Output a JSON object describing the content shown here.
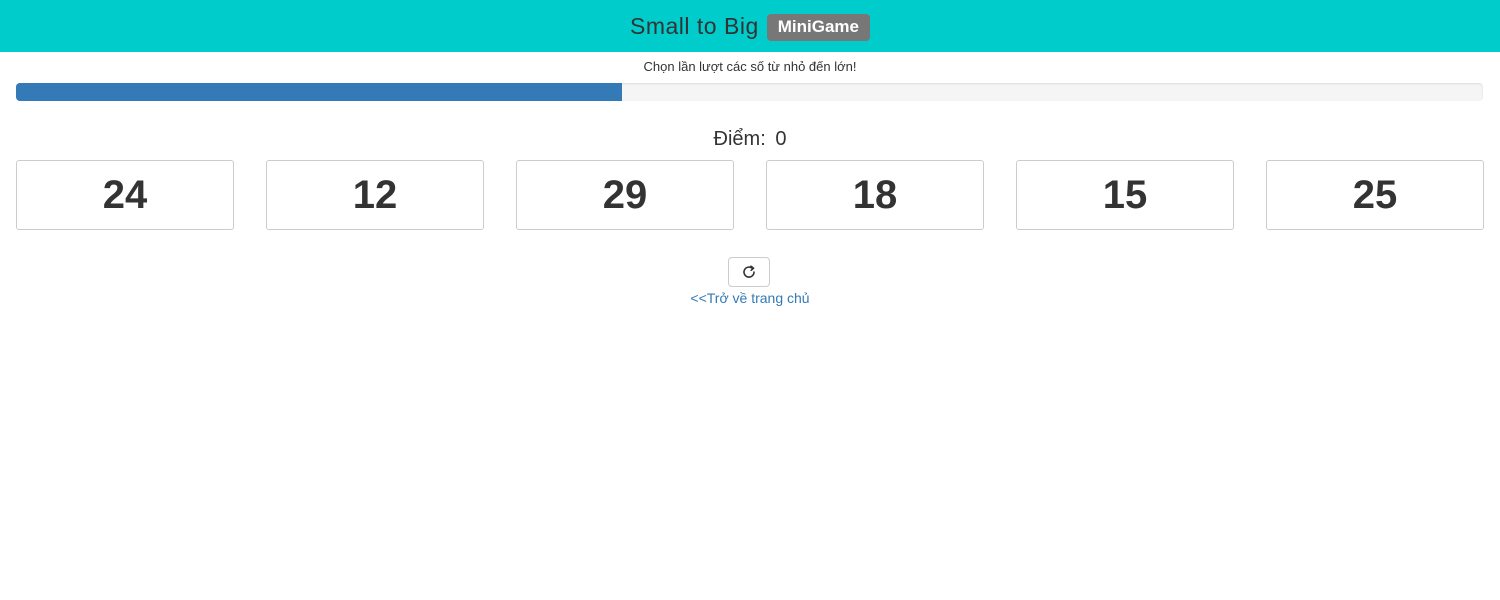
{
  "header": {
    "title": "Small to Big",
    "badge": "MiniGame",
    "background_color": "#00cccc"
  },
  "instruction": "Chọn lần lượt các số từ nhỏ đến lớn!",
  "progress": {
    "fraction": 0.413,
    "fill_color": "#337ab7"
  },
  "score": {
    "label": "Điểm:",
    "value": "0"
  },
  "tiles": [
    "24",
    "12",
    "29",
    "18",
    "15",
    "25"
  ],
  "controls": {
    "refresh_icon": "refresh-icon",
    "home_link": "<<Trở về trang chủ",
    "link_color": "#337ab7"
  }
}
